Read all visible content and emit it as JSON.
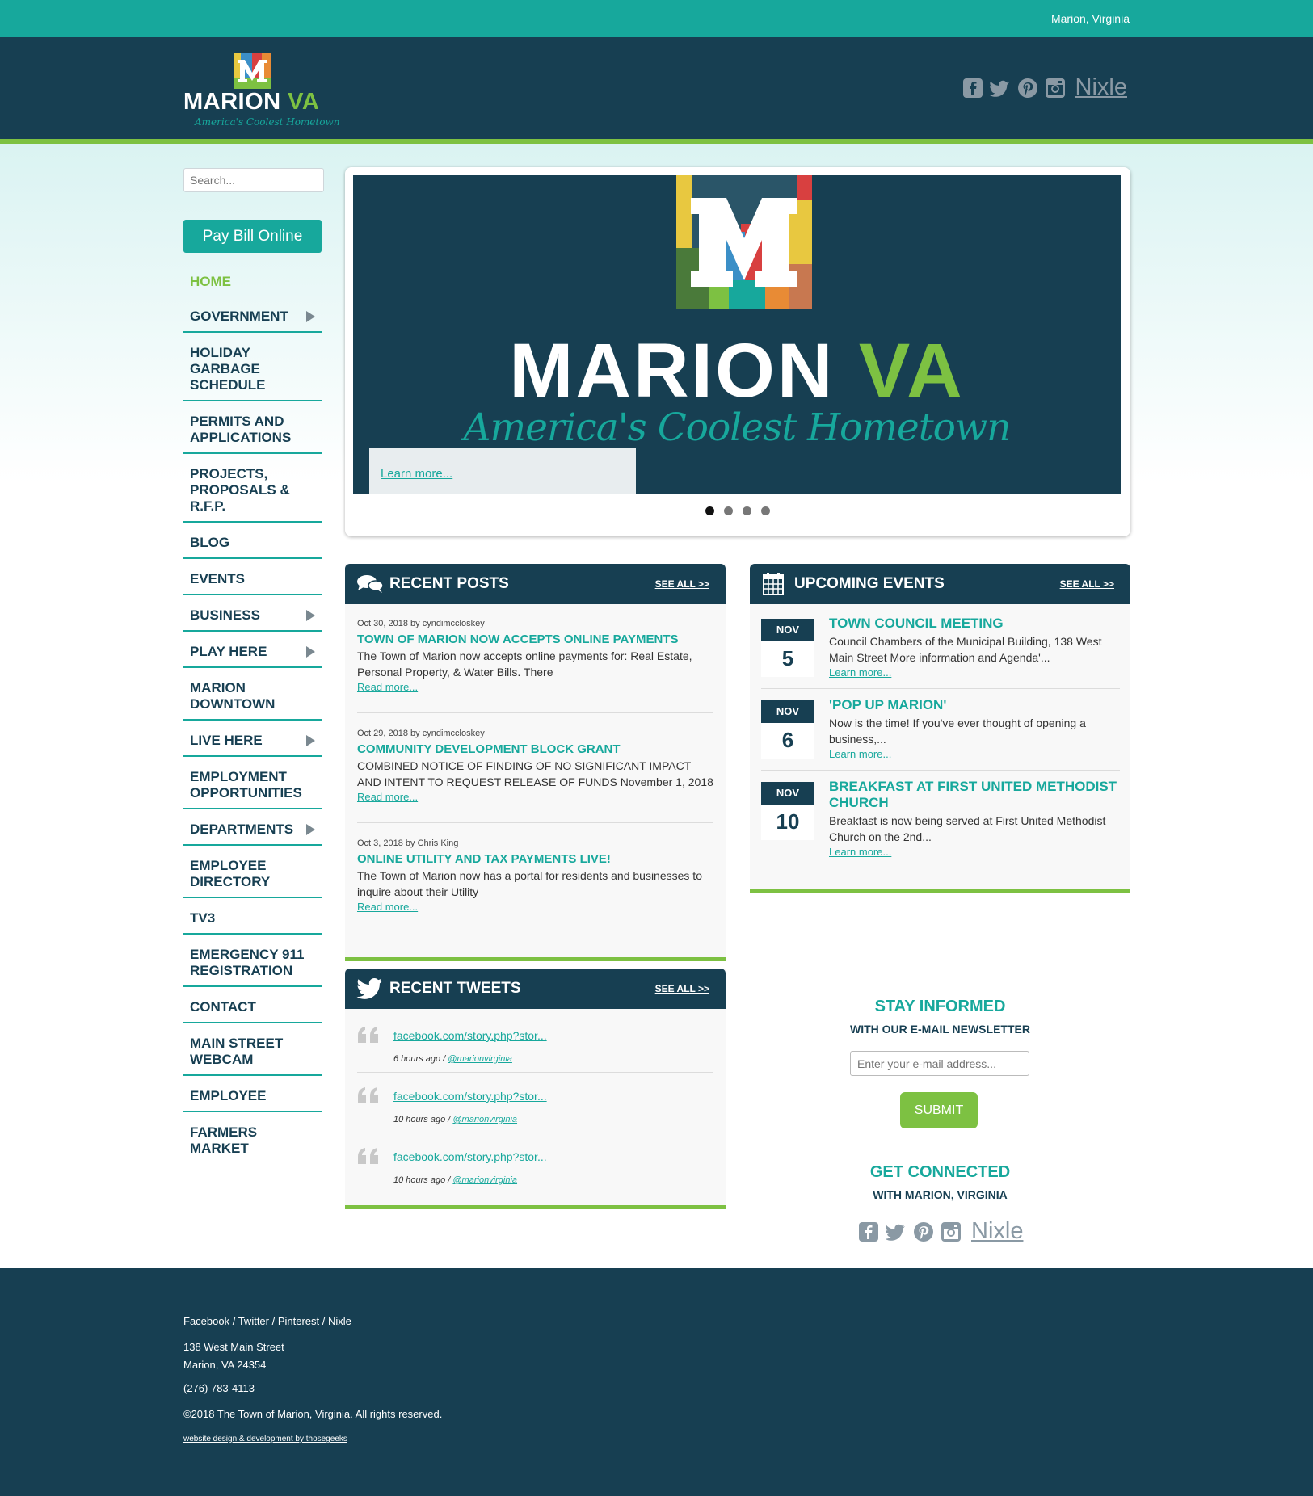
{
  "topbar": {
    "location": "Marion, Virginia"
  },
  "brand": {
    "name_part1": "MARION",
    "name_part2": "VA",
    "tagline": "America's Coolest Hometown",
    "colors": {
      "teal": "#17a89c",
      "navy": "#173f52",
      "green": "#7dc142"
    }
  },
  "social": {
    "icons": [
      "facebook-icon",
      "twitter-icon",
      "pinterest-icon",
      "instagram-icon"
    ],
    "nixle": "Nixle"
  },
  "sidebar": {
    "search_placeholder": "Search...",
    "pay_bill": "Pay Bill Online",
    "nav": [
      {
        "label": "HOME",
        "active": true,
        "submenu": false
      },
      {
        "label": "GOVERNMENT",
        "submenu": true
      },
      {
        "label": "HOLIDAY GARBAGE SCHEDULE",
        "submenu": false
      },
      {
        "label": "PERMITS AND APPLICATIONS",
        "submenu": false
      },
      {
        "label": "PROJECTS, PROPOSALS & R.F.P.",
        "submenu": false
      },
      {
        "label": "BLOG",
        "submenu": false
      },
      {
        "label": "EVENTS",
        "submenu": false
      },
      {
        "label": "BUSINESS",
        "submenu": true
      },
      {
        "label": "PLAY HERE",
        "submenu": true
      },
      {
        "label": "MARION DOWNTOWN",
        "submenu": false
      },
      {
        "label": "LIVE HERE",
        "submenu": true
      },
      {
        "label": "EMPLOYMENT OPPORTUNITIES",
        "submenu": false
      },
      {
        "label": "DEPARTMENTS",
        "submenu": true
      },
      {
        "label": "EMPLOYEE DIRECTORY",
        "submenu": false
      },
      {
        "label": "TV3",
        "submenu": false
      },
      {
        "label": "EMERGENCY 911 REGISTRATION",
        "submenu": false
      },
      {
        "label": "CONTACT",
        "submenu": false
      },
      {
        "label": "MAIN STREET WEBCAM",
        "submenu": false
      },
      {
        "label": "EMPLOYEE",
        "submenu": false
      },
      {
        "label": "FARMERS MARKET",
        "submenu": false
      }
    ]
  },
  "slider": {
    "word1": "MARION",
    "word2": "VA",
    "tagline": "America's Coolest Hometown",
    "learn_more": "Learn more...",
    "slide_count": 4,
    "active_index": 0
  },
  "recent_posts": {
    "title": "RECENT POSTS",
    "see_all": "SEE ALL >>",
    "posts": [
      {
        "meta": "Oct 30, 2018 by cyndimccloskey",
        "title": "TOWN OF MARION NOW ACCEPTS ONLINE PAYMENTS",
        "body": "The Town of Marion now accepts online payments for: Real Estate, Personal Property, & Water Bills. There",
        "more": "Read more..."
      },
      {
        "meta": "Oct 29, 2018 by cyndimccloskey",
        "title": "COMMUNITY DEVELOPMENT BLOCK GRANT",
        "body": "COMBINED NOTICE OF FINDING OF NO SIGNIFICANT IMPACT AND INTENT TO REQUEST RELEASE OF FUNDS   November 1, 2018",
        "more": "Read more..."
      },
      {
        "meta": "Oct 3, 2018 by Chris King",
        "title": "ONLINE UTILITY AND TAX PAYMENTS LIVE!",
        "body": "The Town of Marion now has a portal for residents and businesses to inquire about their Utility",
        "more": "Read more..."
      }
    ]
  },
  "upcoming_events": {
    "title": "UPCOMING EVENTS",
    "see_all": "SEE ALL >>",
    "events": [
      {
        "month": "NOV",
        "day": "5",
        "title": "TOWN COUNCIL MEETING",
        "body": "Council Chambers of the Municipal Building, 138 West Main Street More information and Agenda'...",
        "more": "Learn more..."
      },
      {
        "month": "NOV",
        "day": "6",
        "title": "'POP UP MARION'",
        "body": "Now is the time! If you've ever thought of opening a business,...",
        "more": "Learn more..."
      },
      {
        "month": "NOV",
        "day": "10",
        "title": "BREAKFAST AT FIRST UNITED METHODIST CHURCH",
        "body": "Breakfast is now being served at First United Methodist Church on the 2nd...",
        "more": "Learn more..."
      }
    ]
  },
  "recent_tweets": {
    "title": "RECENT TWEETS",
    "see_all": "SEE ALL >>",
    "tweets": [
      {
        "link": "facebook.com/story.php?stor...",
        "time": "6 hours ago / ",
        "handle": "@marionvirginia"
      },
      {
        "link": "facebook.com/story.php?stor...",
        "time": "10 hours ago / ",
        "handle": "@marionvirginia"
      },
      {
        "link": "facebook.com/story.php?stor...",
        "time": "10 hours ago / ",
        "handle": "@marionvirginia"
      }
    ]
  },
  "newsletter": {
    "title": "STAY INFORMED",
    "subtitle": "WITH OUR E-MAIL NEWSLETTER",
    "placeholder": "Enter your e-mail address...",
    "submit": "SUBMIT"
  },
  "connected": {
    "title": "GET CONNECTED",
    "subtitle": "WITH MARION, VIRGINIA"
  },
  "footer": {
    "links": [
      "Facebook",
      "Twitter",
      "Pinterest",
      "Nixle"
    ],
    "address1": "138 West Main Street",
    "address2": "Marion, VA 24354",
    "phone": "(276) 783-4113",
    "copyright": "©2018 The Town of Marion, Virginia. All rights reserved.",
    "credit": "website design & development by thosegeeks"
  }
}
